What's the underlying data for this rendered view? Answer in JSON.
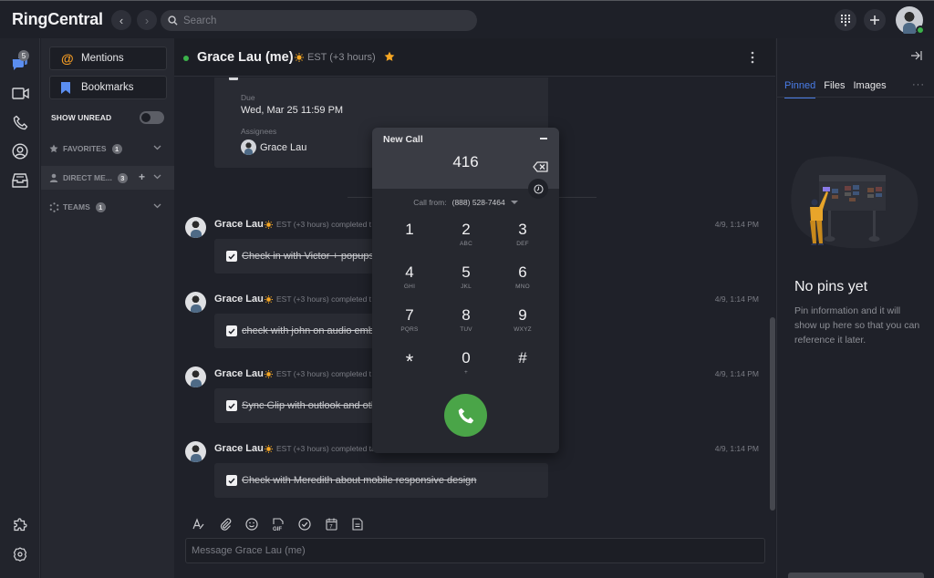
{
  "app": {
    "brand": "RingCentral",
    "search_placeholder": "Search"
  },
  "rail": {
    "messages_badge": "5",
    "items": [
      "messages",
      "video",
      "phone",
      "contacts",
      "inbox"
    ],
    "bottom_items": [
      "apps",
      "settings"
    ]
  },
  "left_panel": {
    "mentions_label": "Mentions",
    "bookmarks_label": "Bookmarks",
    "show_unread_label": "SHOW UNREAD",
    "show_unread_on": false,
    "sections": [
      {
        "label": "FAVORITES",
        "count": "1"
      },
      {
        "label": "DIRECT ME...",
        "count": "3"
      },
      {
        "label": "TEAMS",
        "count": "1"
      }
    ]
  },
  "conversation": {
    "title": "Grace Lau (me)",
    "timezone": "EST (+3 hours)",
    "task_card": {
      "due_label": "Due",
      "due_value": "Wed, Mar 25 11:59 PM",
      "assignees_label": "Assignees",
      "assignee_name": "Grace Lau"
    },
    "messages": [
      {
        "name": "Grace Lau",
        "meta": "EST (+3 hours) completed t",
        "time": "4/9, 1:14 PM",
        "task": "Check in with Victor + popups"
      },
      {
        "name": "Grace Lau",
        "meta": "EST (+3 hours) completed t",
        "time": "4/9, 1:14 PM",
        "task": "check with john on audio embe"
      },
      {
        "name": "Grace Lau",
        "meta": "EST (+3 hours) completed t",
        "time": "4/9, 1:14 PM",
        "task": "Sync Glip with outlook and oth"
      },
      {
        "name": "Grace Lau",
        "meta": "EST (+3 hours) completed ta...",
        "time": "4/9, 1:14 PM",
        "task": "Check with Meredith about mobile responsive design"
      }
    ],
    "composer_placeholder": "Message Grace Lau (me)"
  },
  "right_panel": {
    "tabs": [
      {
        "label": "Pinned",
        "active": true
      },
      {
        "label": "Files",
        "active": false
      },
      {
        "label": "Images",
        "active": false
      }
    ],
    "more_label": "···",
    "empty_title": "No pins yet",
    "empty_desc": "Pin information and it will show up here so that you can reference it later."
  },
  "dialer": {
    "title": "New Call",
    "number": "416",
    "call_from_label": "Call from:",
    "call_from_number": "(888) 528-7464",
    "keys": [
      {
        "digit": "1",
        "letters": ""
      },
      {
        "digit": "2",
        "letters": "ABC"
      },
      {
        "digit": "3",
        "letters": "DEF"
      },
      {
        "digit": "4",
        "letters": "GHI"
      },
      {
        "digit": "5",
        "letters": "JKL"
      },
      {
        "digit": "6",
        "letters": "MNO"
      },
      {
        "digit": "7",
        "letters": "PQRS"
      },
      {
        "digit": "8",
        "letters": "TUV"
      },
      {
        "digit": "9",
        "letters": "WXYZ"
      },
      {
        "digit": "*",
        "letters": ""
      },
      {
        "digit": "0",
        "letters": "+"
      },
      {
        "digit": "#",
        "letters": ""
      }
    ]
  },
  "colors": {
    "accent": "#4a7de8",
    "presence": "#3bb24a",
    "call_button": "#4aa548",
    "mention": "#f29b24",
    "bookmark": "#5b8ef0",
    "star": "#f5a623"
  }
}
